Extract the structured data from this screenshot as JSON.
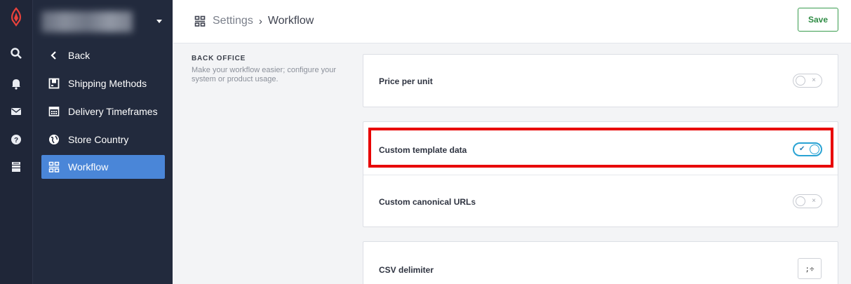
{
  "colors": {
    "rail_bg": "#1f2638",
    "sidebar_bg": "#222a3d",
    "active_nav": "#4a86d8",
    "save_green": "#2f8c45",
    "toggle_on": "#2aa3d4",
    "highlight": "#e80000"
  },
  "rail": {
    "icons": [
      "lightspeed-logo-icon",
      "search-icon",
      "bell-icon",
      "mail-icon",
      "help-icon",
      "store-icon"
    ]
  },
  "sidebar": {
    "store_selector": {
      "icon": "chevron-down-icon"
    },
    "items": [
      {
        "label": "Back",
        "icon": "chevron-left-icon",
        "active": false
      },
      {
        "label": "Shipping Methods",
        "icon": "shipping-icon",
        "active": false
      },
      {
        "label": "Delivery Timeframes",
        "icon": "calendar-icon",
        "active": false
      },
      {
        "label": "Store Country",
        "icon": "globe-icon",
        "active": false
      },
      {
        "label": "Workflow",
        "icon": "workflow-icon",
        "active": true
      }
    ]
  },
  "header": {
    "breadcrumb_parent": "Settings",
    "breadcrumb_sep": "›",
    "breadcrumb_current": "Workflow",
    "save_label": "Save"
  },
  "section": {
    "title": "BACK OFFICE",
    "description": "Make your workflow easier; configure your system or product usage."
  },
  "settings": {
    "price_per_unit": {
      "label": "Price per unit",
      "enabled": false
    },
    "custom_template_data": {
      "label": "Custom template data",
      "enabled": true
    },
    "custom_canonical_urls": {
      "label": "Custom canonical URLs",
      "enabled": false
    },
    "csv_delimiter": {
      "label": "CSV delimiter",
      "value": ";÷"
    }
  }
}
